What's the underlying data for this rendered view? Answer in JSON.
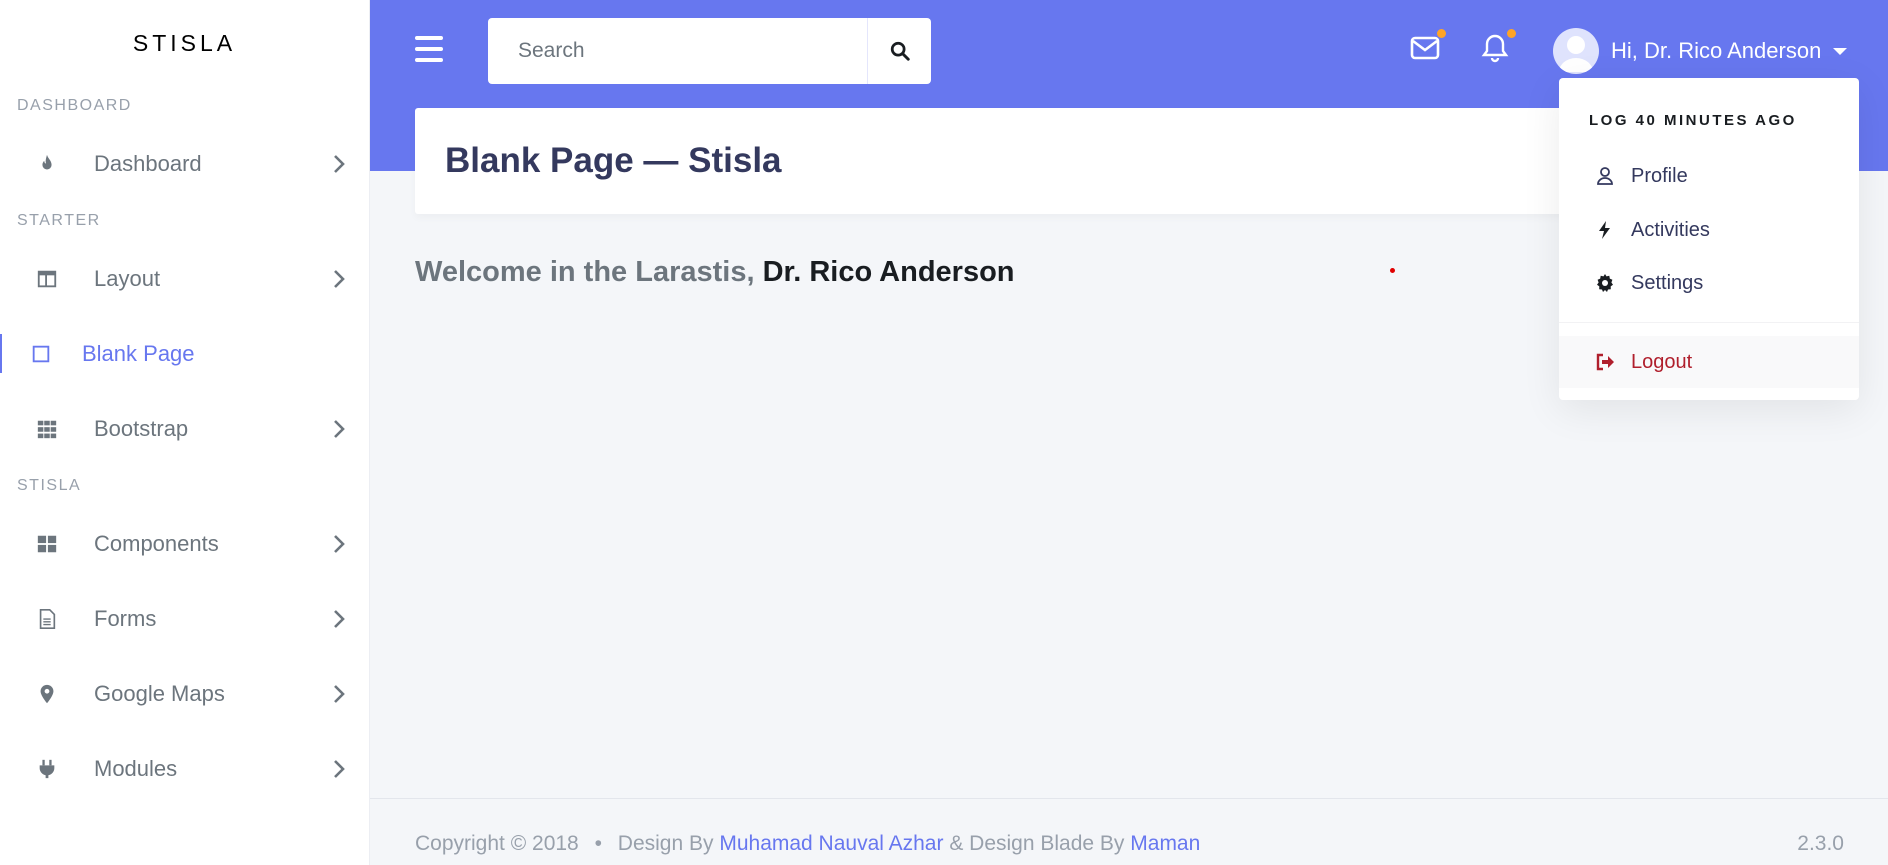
{
  "brand": "STISLA",
  "sidebar": {
    "groups": [
      {
        "header": "DASHBOARD",
        "items": [
          {
            "label": "Dashboard",
            "icon": "fire-icon"
          }
        ]
      },
      {
        "header": "STARTER",
        "items": [
          {
            "label": "Layout",
            "icon": "columns-icon"
          },
          {
            "label": "Blank Page",
            "icon": "square-icon"
          },
          {
            "label": "Bootstrap",
            "icon": "grid-icon"
          }
        ]
      },
      {
        "header": "STISLA",
        "items": [
          {
            "label": "Components",
            "icon": "components-icon"
          },
          {
            "label": "Forms",
            "icon": "file-icon"
          },
          {
            "label": "Google Maps",
            "icon": "map-marker-icon"
          },
          {
            "label": "Modules",
            "icon": "plug-icon"
          }
        ]
      }
    ],
    "active_item": "Blank Page"
  },
  "navbar": {
    "search_placeholder": "Search",
    "user_greeting": "Hi, Dr. Rico Anderson",
    "accent_color": "#6777ef",
    "badge_color": "#ffa426"
  },
  "dropdown": {
    "title": "LOG 40 MINUTES AGO",
    "items": [
      {
        "label": "Profile",
        "icon": "user-icon"
      },
      {
        "label": "Activities",
        "icon": "bolt-icon"
      },
      {
        "label": "Settings",
        "icon": "cog-icon"
      }
    ],
    "logout": {
      "label": "Logout",
      "icon": "sign-out-icon",
      "color": "#b01f2c"
    }
  },
  "main": {
    "title": "Blank Page — Stisla",
    "welcome_prefix": "Welcome in the Larastis,",
    "welcome_name": "Dr. Rico Anderson"
  },
  "footer": {
    "copyright": "Copyright © 2018",
    "separator": "•",
    "design_by": "Design By",
    "designer": "Muhamad Nauval Azhar",
    "blade_by": "& Design Blade By",
    "blade_designer": "Maman",
    "version": "2.3.0"
  }
}
